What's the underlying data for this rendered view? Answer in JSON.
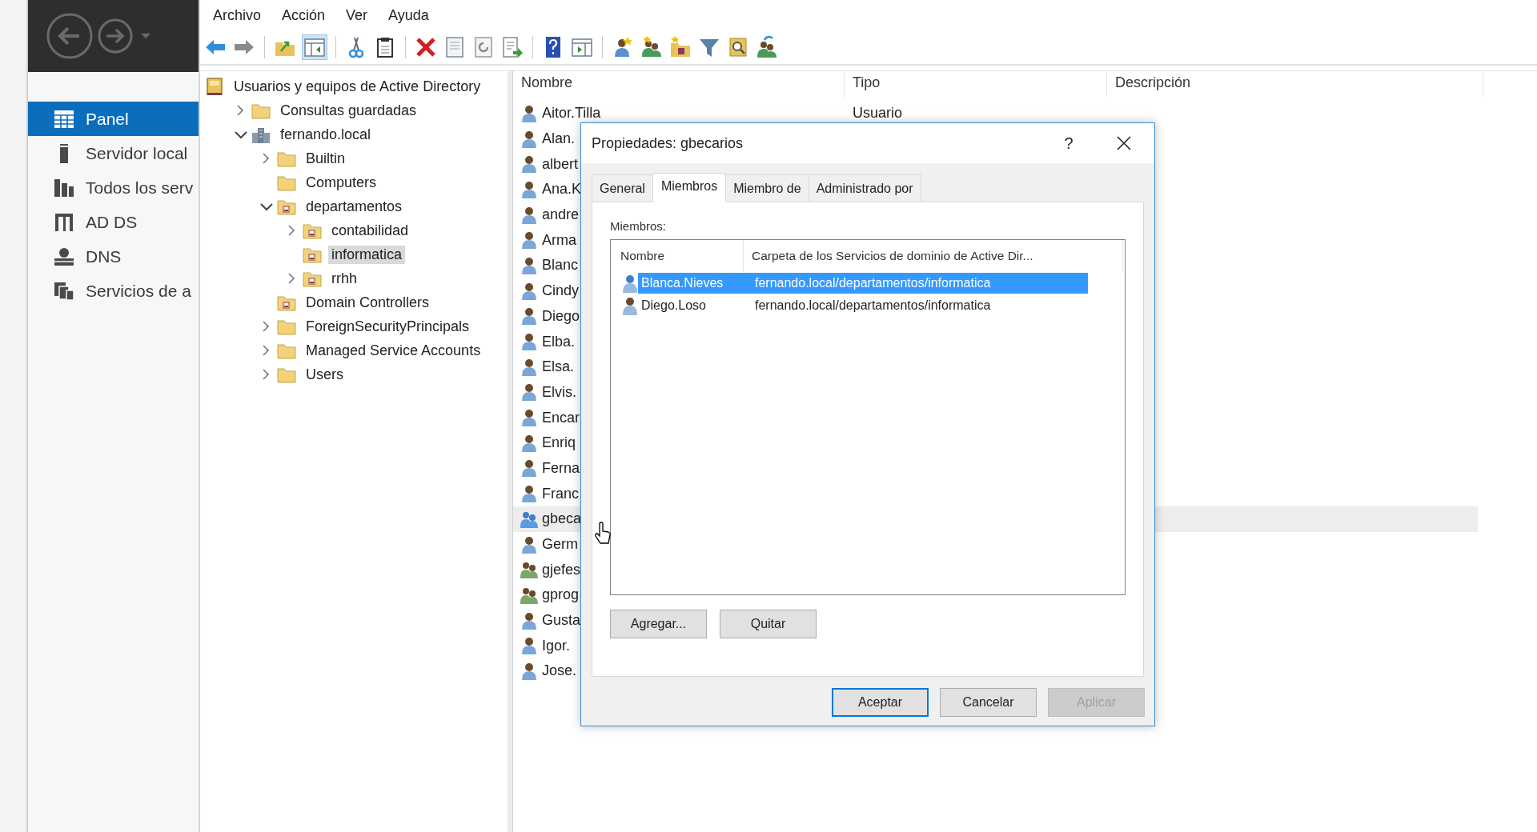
{
  "sidebar": {
    "items": [
      {
        "label": "Panel",
        "kind": "dashboard",
        "selected": true
      },
      {
        "label": "Servidor local",
        "kind": "server",
        "selected": false
      },
      {
        "label": "Todos los serv",
        "kind": "servers",
        "selected": false
      },
      {
        "label": "AD DS",
        "kind": "adds",
        "selected": false
      },
      {
        "label": "DNS",
        "kind": "dns",
        "selected": false
      },
      {
        "label": "Servicios de a",
        "kind": "files",
        "selected": false
      }
    ]
  },
  "menu": [
    "Archivo",
    "Acción",
    "Ver",
    "Ayuda"
  ],
  "tree": [
    {
      "label": "Usuarios y equipos de Active Directory",
      "kind": "root",
      "selected": false,
      "children": [
        {
          "label": "Consultas guardadas",
          "kind": "folder",
          "expanded": false,
          "selected": false
        },
        {
          "label": "fernando.local",
          "kind": "domain",
          "expanded": true,
          "selected": false,
          "children": [
            {
              "label": "Builtin",
              "kind": "folder",
              "expanded": false,
              "selected": false
            },
            {
              "label": "Computers",
              "kind": "folder",
              "selected": false
            },
            {
              "label": "departamentos",
              "kind": "ou",
              "expanded": true,
              "selected": false,
              "children": [
                {
                  "label": "contabilidad",
                  "kind": "ou",
                  "expanded": false,
                  "selected": false
                },
                {
                  "label": "informatica",
                  "kind": "ou",
                  "selected": true
                },
                {
                  "label": "rrhh",
                  "kind": "ou",
                  "expanded": false,
                  "selected": false
                }
              ]
            },
            {
              "label": "Domain Controllers",
              "kind": "ou",
              "selected": false
            },
            {
              "label": "ForeignSecurityPrincipals",
              "kind": "folder",
              "expanded": false,
              "selected": false
            },
            {
              "label": "Managed Service Accounts",
              "kind": "folder",
              "expanded": false,
              "selected": false
            },
            {
              "label": "Users",
              "kind": "folder",
              "expanded": false,
              "selected": false
            }
          ]
        }
      ]
    }
  ],
  "list": {
    "columns": [
      "Nombre",
      "Tipo",
      "Descripción"
    ],
    "rows": [
      {
        "name": "Aitor.Tilla",
        "type": "Usuario",
        "kind": "user",
        "selected": false
      },
      {
        "name": "Alan.",
        "kind": "user",
        "selected": false
      },
      {
        "name": "albert",
        "kind": "user",
        "selected": false
      },
      {
        "name": "Ana.K",
        "kind": "user",
        "selected": false
      },
      {
        "name": "andre",
        "kind": "user",
        "selected": false
      },
      {
        "name": "Arma",
        "kind": "user",
        "selected": false
      },
      {
        "name": "Blanc",
        "kind": "user",
        "selected": false
      },
      {
        "name": "Cindy",
        "kind": "user",
        "selected": false
      },
      {
        "name": "Diego",
        "kind": "user",
        "selected": false
      },
      {
        "name": "Elba.",
        "kind": "user",
        "selected": false
      },
      {
        "name": "Elsa.",
        "kind": "user",
        "selected": false
      },
      {
        "name": "Elvis.",
        "kind": "user",
        "selected": false
      },
      {
        "name": "Encar",
        "kind": "user",
        "selected": false
      },
      {
        "name": "Enriq",
        "kind": "user",
        "selected": false
      },
      {
        "name": "Ferna",
        "kind": "user",
        "selected": false
      },
      {
        "name": "Franc",
        "kind": "user",
        "selected": false
      },
      {
        "name": "gbeca",
        "kind": "security-group",
        "selected": true
      },
      {
        "name": "Germ",
        "kind": "user",
        "selected": false
      },
      {
        "name": "gjefes",
        "kind": "group",
        "selected": false
      },
      {
        "name": "gprog",
        "kind": "group",
        "selected": false
      },
      {
        "name": "Gusta",
        "kind": "user",
        "selected": false
      },
      {
        "name": "Igor.",
        "kind": "user",
        "selected": false
      },
      {
        "name": "Jose.",
        "kind": "user",
        "selected": false
      }
    ]
  },
  "dialog": {
    "title": "Propiedades: gbecarios",
    "help": "?",
    "tabs": [
      {
        "label": "General",
        "selected": false
      },
      {
        "label": "Miembros",
        "selected": true
      },
      {
        "label": "Miembro de",
        "selected": false
      },
      {
        "label": "Administrado por",
        "selected": false
      }
    ],
    "members_label": "Miembros:",
    "columns": [
      "Nombre",
      "Carpeta de los Servicios de dominio de Active Dir..."
    ],
    "members": [
      {
        "name": "Blanca.Nieves",
        "folder": "fernando.local/departamentos/informatica",
        "selected": true
      },
      {
        "name": "Diego.Loso",
        "folder": "fernando.local/departamentos/informatica",
        "selected": false
      }
    ],
    "member_buttons": [
      "Agregar...",
      "Quitar"
    ],
    "buttons": [
      {
        "label": "Aceptar",
        "default": true,
        "disabled": false
      },
      {
        "label": "Cancelar",
        "default": false,
        "disabled": false
      },
      {
        "label": "Aplicar",
        "default": false,
        "disabled": true
      }
    ]
  }
}
